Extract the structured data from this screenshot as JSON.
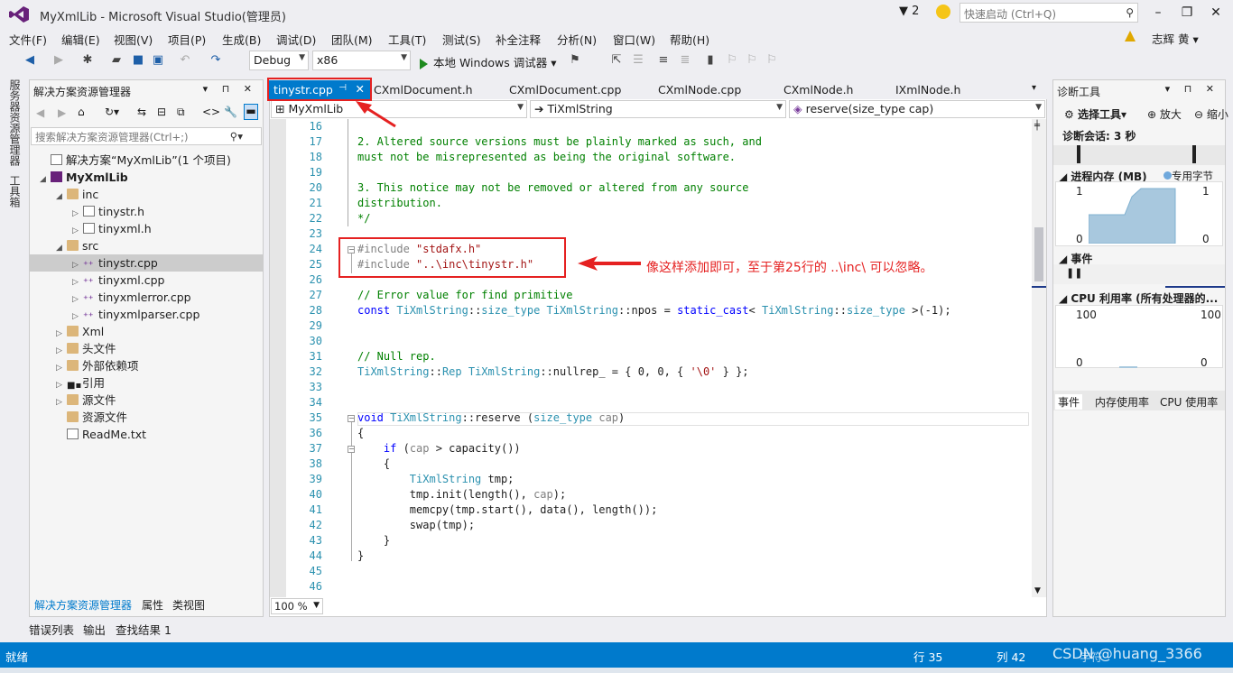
{
  "window": {
    "title": "MyXmlLib - Microsoft Visual Studio(管理员)",
    "notifications": "2",
    "quick_launch_placeholder": "快速启动 (Ctrl+Q)",
    "user": "志辉 黄"
  },
  "menu": [
    "文件(F)",
    "编辑(E)",
    "视图(V)",
    "项目(P)",
    "生成(B)",
    "调试(D)",
    "团队(M)",
    "工具(T)",
    "测试(S)",
    "补全注释",
    "分析(N)",
    "窗口(W)",
    "帮助(H)"
  ],
  "toolbar": {
    "config": "Debug",
    "platform": "x86",
    "run_label": "本地 Windows 调试器"
  },
  "left_sidebar": {
    "server_explorer": "服务器资源管理器",
    "toolbox": "工具箱"
  },
  "solution_explorer": {
    "title": "解决方案资源管理器",
    "search_placeholder": "搜索解决方案资源管理器(Ctrl+;)",
    "tree": [
      {
        "label": "解决方案“MyXmlLib”(1 个项目)",
        "icon": "solution-icon"
      },
      {
        "label": "MyXmlLib",
        "icon": "project-icon"
      },
      {
        "label": "inc",
        "icon": "folder-icon"
      },
      {
        "label": "tinystr.h",
        "icon": "header-file-icon"
      },
      {
        "label": "tinyxml.h",
        "icon": "header-file-icon"
      },
      {
        "label": "src",
        "icon": "folder-icon"
      },
      {
        "label": "tinystr.cpp",
        "icon": "cpp-file-icon"
      },
      {
        "label": "tinyxml.cpp",
        "icon": "cpp-file-icon"
      },
      {
        "label": "tinyxmlerror.cpp",
        "icon": "cpp-file-icon"
      },
      {
        "label": "tinyxmlparser.cpp",
        "icon": "cpp-file-icon"
      },
      {
        "label": "Xml",
        "icon": "folder-icon"
      },
      {
        "label": "头文件",
        "icon": "folder-icon"
      },
      {
        "label": "外部依赖项",
        "icon": "folder-icon"
      },
      {
        "label": "引用",
        "icon": "references-icon"
      },
      {
        "label": "源文件",
        "icon": "folder-icon"
      },
      {
        "label": "资源文件",
        "icon": "folder-icon"
      },
      {
        "label": "ReadMe.txt",
        "icon": "text-file-icon"
      }
    ],
    "bottom_tabs": [
      "解决方案资源管理器",
      "属性",
      "类视图"
    ]
  },
  "editor": {
    "tabs": [
      "tinystr.cpp",
      "CXmlDocument.h",
      "CXmlDocument.cpp",
      "CXmlNode.cpp",
      "CXmlNode.h",
      "IXmlNode.h"
    ],
    "nav": {
      "project": "MyXmlLib",
      "scope": "TiXmlString",
      "member": "reserve(size_type cap)"
    },
    "line_numbers": [
      "16",
      "17",
      "18",
      "19",
      "20",
      "21",
      "22",
      "23",
      "24",
      "25",
      "26",
      "27",
      "28",
      "29",
      "30",
      "31",
      "32",
      "33",
      "34",
      "35",
      "36",
      "37",
      "38",
      "39",
      "40",
      "41",
      "42",
      "43",
      "44",
      "45",
      "46"
    ],
    "zoom": "100 %",
    "annotation": "像这样添加即可，至于第25行的 ..\\inc\\ 可以忽略。"
  },
  "diagnostics": {
    "title": "诊断工具",
    "select_tools": "选择工具",
    "zoom_in": "放大",
    "zoom_out": "缩小",
    "session": "诊断会话: 3 秒",
    "memory_title": "进程内存 (MB)",
    "memory_legend": "专用字节",
    "mem_max": "1",
    "mem_min": "0",
    "events": "事件",
    "cpu_title": "CPU 利用率 (所有处理器的...",
    "cpu_max": "100",
    "cpu_min": "0",
    "bottom_tabs": [
      "事件",
      "内存使用率",
      "CPU 使用率"
    ]
  },
  "output_tabs": [
    "错误列表",
    "输出",
    "查找结果 1"
  ],
  "status": {
    "left": "就绪",
    "line": "行 35",
    "col": "列 42",
    "watermark": "CSDN @huang_3366",
    "extra": "字符"
  }
}
